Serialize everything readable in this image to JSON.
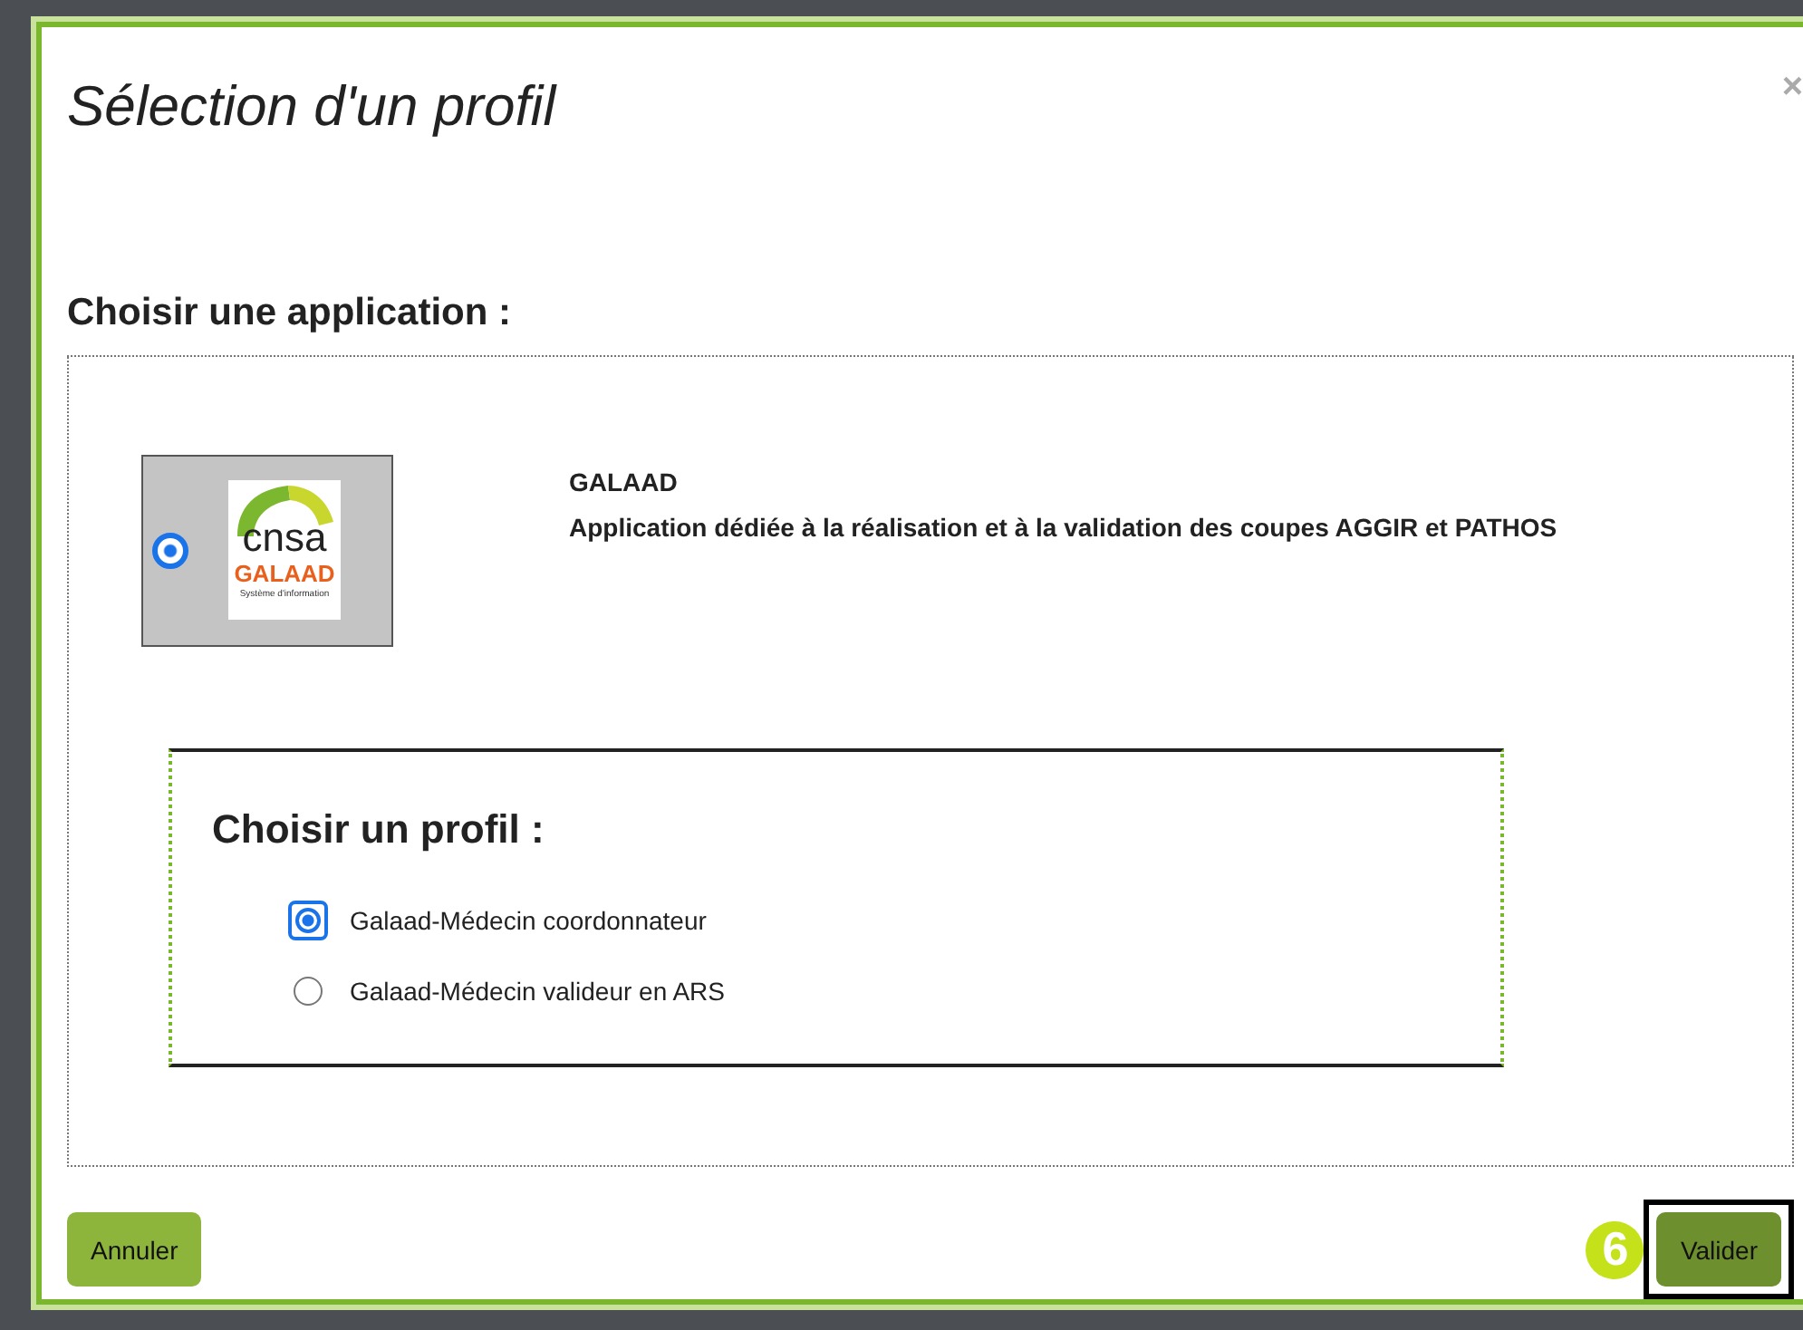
{
  "dialog": {
    "title": "Sélection d'un profil",
    "close": "×",
    "application_section": {
      "heading": "Choisir une application :",
      "applications": [
        {
          "logo_texts": [
            "cnsa",
            "GALAAD",
            "Système d'information"
          ],
          "name": "GALAAD",
          "description": "Application dédiée à la réalisation et à la validation des coupes AGGIR et PATHOS",
          "selected": true
        }
      ]
    },
    "profile_section": {
      "heading": "Choisir un profil :",
      "profiles": [
        {
          "label": "Galaad-Médecin coordonnateur",
          "selected": true,
          "focused": true
        },
        {
          "label": "Galaad-Médecin valideur en ARS",
          "selected": false,
          "focused": false
        }
      ]
    },
    "buttons": [
      {
        "label": "Annuler",
        "kind": "secondary"
      },
      {
        "label": "Valider",
        "kind": "primary",
        "highlighted": true,
        "step": "6"
      }
    ]
  }
}
